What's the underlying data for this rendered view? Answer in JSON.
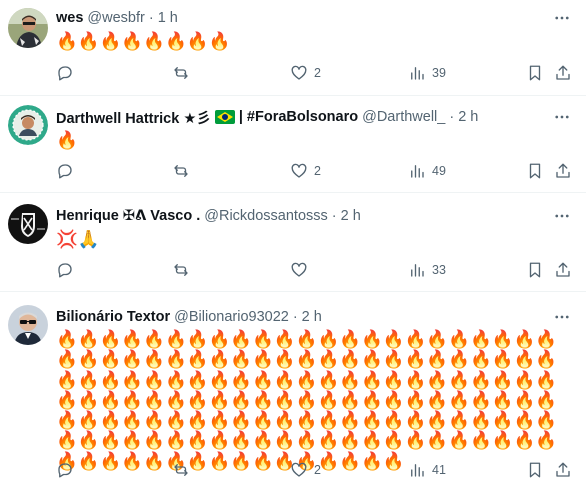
{
  "tweets": [
    {
      "name": "wes",
      "handle": "@wesbfr",
      "time": "1 h",
      "content": "🔥🔥🔥🔥🔥🔥🔥🔥",
      "stats": {
        "replies": "",
        "reposts": "",
        "likes": "2",
        "views": "39"
      }
    },
    {
      "name": "Darthwell Hattrick ★彡",
      "name_suffix": "| #ForaBolsonaro",
      "handle": "@Darthwell_",
      "time": "2 h",
      "content": "🔥",
      "stats": {
        "replies": "",
        "reposts": "",
        "likes": "2",
        "views": "49"
      }
    },
    {
      "name": "Henrique ✠ᕕ Vasco .",
      "handle": "@Rickdossantosss",
      "time": "2 h",
      "content": "💢🙏",
      "stats": {
        "replies": "",
        "reposts": "",
        "likes": "",
        "views": "33"
      }
    },
    {
      "name": "Bilionário Textor",
      "handle": "@Bilionario93022",
      "time": "2 h",
      "content": "🔥🔥🔥🔥🔥🔥🔥🔥🔥🔥🔥🔥🔥🔥🔥🔥🔥🔥🔥🔥🔥🔥🔥🔥🔥🔥🔥🔥🔥🔥🔥🔥🔥🔥🔥🔥🔥🔥🔥🔥🔥🔥🔥🔥🔥🔥🔥🔥🔥🔥🔥🔥🔥🔥🔥🔥🔥🔥🔥🔥🔥🔥🔥🔥🔥🔥🔥🔥🔥🔥🔥🔥🔥🔥🔥🔥🔥🔥🔥🔥🔥🔥🔥🔥🔥🔥🔥🔥🔥🔥🔥🔥🔥🔥🔥🔥🔥🔥🔥🔥🔥🔥🔥🔥🔥🔥🔥🔥🔥🔥🔥🔥🔥🔥🔥🔥🔥🔥🔥🔥🔥🔥🔥🔥🔥🔥🔥🔥🔥🔥🔥🔥🔥🔥🔥🔥🔥🔥🔥🔥🔥🔥🔥🔥🔥🔥🔥🔥🔥🔥🔥🔥🔥🔥",
      "stats": {
        "replies": "",
        "reposts": "",
        "likes": "2",
        "views": "41"
      }
    }
  ],
  "colors": {
    "text": "#0f1419",
    "muted": "#536471",
    "divider": "#eff3f4",
    "flag_green": "#009c3b",
    "flag_yellow": "#ffdf00",
    "flag_blue": "#002776"
  },
  "icons": {
    "more": "more-horizontal-icon",
    "reply": "reply-icon",
    "repost": "repost-icon",
    "like": "heart-icon",
    "views": "views-chart-icon",
    "bookmark": "bookmark-icon",
    "share": "share-icon",
    "flag": "brazil-flag-icon"
  }
}
